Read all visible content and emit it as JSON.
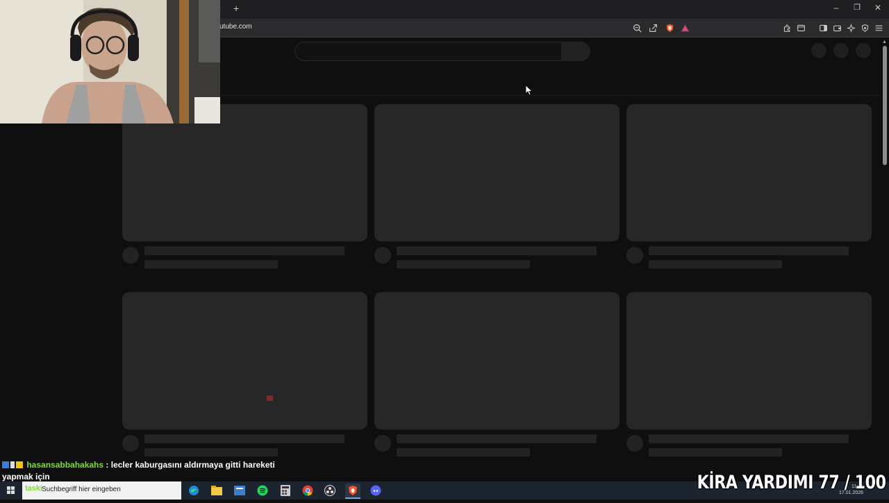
{
  "browser": {
    "url": "utube.com",
    "new_tab": "+",
    "tab_chevron": "‹",
    "window_controls": {
      "minimize": "–",
      "restore": "❐",
      "close": "✕"
    },
    "toolbar_icons": [
      "zoom-icon",
      "share-icon",
      "brave-shield-icon",
      "brave-rewards-icon",
      "extensions-icon",
      "tab-search-icon",
      "sidebar-icon",
      "wallet-icon",
      "leo-ai-icon",
      "vpn-icon",
      "menu-icon"
    ]
  },
  "chat": {
    "username": "hasansabbahakahs",
    "separator": ":",
    "message": "lecler kaburgasını aldırmaya gitti hareketi yapmak için"
  },
  "taskbar": {
    "search_prefix": "taski",
    "search_placeholder": "Suchbegriff hier eingeben",
    "clock_time": "11:43",
    "clock_date": "17.01.2026",
    "apps": [
      "edge-icon",
      "file-explorer-icon",
      "app-icon",
      "spotify-icon",
      "calculator-icon",
      "chrome-icon",
      "obs-icon",
      "brave-icon",
      "discord-icon"
    ]
  },
  "overlay": {
    "kira_text": "KİRA YARDIMI  77 / 100"
  },
  "colors": {
    "page_bg": "#0f0f0f",
    "skeleton": "#272727",
    "chat_username": "#7fdc2f"
  }
}
